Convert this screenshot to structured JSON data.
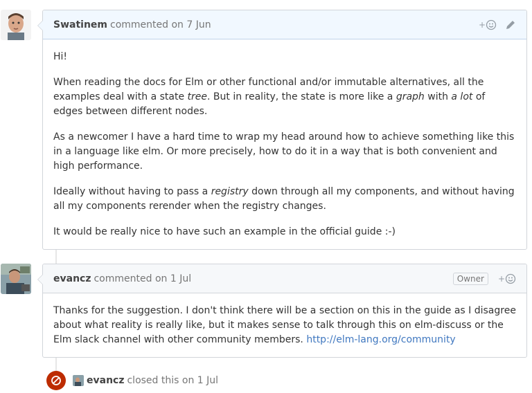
{
  "comments": [
    {
      "author": "Swatinem",
      "action": "commented on 7 Jun",
      "paragraphs": [
        {
          "segments": [
            {
              "text": "Hi!"
            }
          ]
        },
        {
          "segments": [
            {
              "text": "When reading the docs for Elm or other functional and/or immutable alternatives, all the examples deal with a state "
            },
            {
              "text": "tree",
              "em": true
            },
            {
              "text": ". But in reality, the state is more like a "
            },
            {
              "text": "graph",
              "em": true
            },
            {
              "text": " with "
            },
            {
              "text": "a lot",
              "em": true
            },
            {
              "text": " of edges between different nodes."
            }
          ]
        },
        {
          "segments": [
            {
              "text": "As a newcomer I have a hard time to wrap my head around how to achieve something like this in a language like elm. Or more precisely, how to do it in a way that is both convenient and high performance."
            }
          ]
        },
        {
          "segments": [
            {
              "text": "Ideally without having to pass a "
            },
            {
              "text": "registry",
              "em": true
            },
            {
              "text": " down through all my components, and without having all my components rerender when the registry changes."
            }
          ]
        },
        {
          "segments": [
            {
              "text": "It would be really nice to have such an example in the official guide :-)"
            }
          ]
        }
      ]
    },
    {
      "author": "evancz",
      "action": "commented on 1 Jul",
      "badge": "Owner",
      "paragraphs": [
        {
          "segments": [
            {
              "text": "Thanks for the suggestion. I don't think there will be a section on this in the guide as I disagree about what reality is really like, but it makes sense to talk through this on elm-discuss or the Elm slack channel with other community members. "
            },
            {
              "text": "http://elm-lang.org/community",
              "link": true
            }
          ]
        }
      ]
    }
  ],
  "event": {
    "actor": "evancz",
    "text": "closed this on 1 Jul",
    "icon": "closed-circle-slash-icon",
    "color": "#bd2c00"
  },
  "icons": {
    "reaction": "add-reaction-icon",
    "edit": "pencil-edit-icon",
    "plus": "+"
  },
  "colors": {
    "header_blue": "#f1f8ff",
    "link": "#4078c0",
    "closed_red": "#bd2c00"
  }
}
